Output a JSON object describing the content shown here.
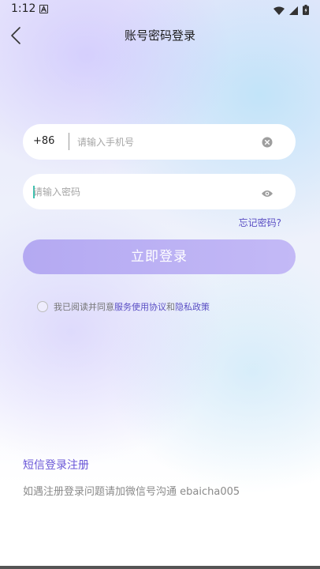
{
  "status_bar": {
    "time": "1:12"
  },
  "header": {
    "title": "账号密码登录"
  },
  "form": {
    "country_code": "+86",
    "phone_placeholder": "请输入手机号",
    "password_placeholder": "请输入密码",
    "forgot_password": "忘记密码?",
    "login_button": "立即登录"
  },
  "agreement": {
    "prefix": "我已阅读并同意",
    "service_link": "服务使用协议",
    "and": "和",
    "privacy_link": "隐私政策"
  },
  "footer": {
    "sms_register": "短信登录注册",
    "help": "如遇注册登录问题请加微信号沟通 ebaicha005"
  },
  "colors": {
    "accent": "#6a57d8",
    "link": "#5b4fc4",
    "button": "#b9aef4"
  },
  "icons": [
    "back-arrow-icon",
    "clear-icon",
    "eye-icon",
    "wifi-icon",
    "signal-icon",
    "battery-icon",
    "notification-a-icon"
  ]
}
